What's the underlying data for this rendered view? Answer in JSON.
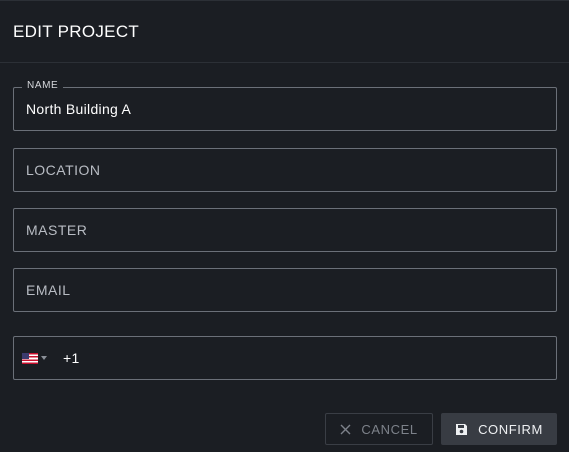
{
  "dialog": {
    "title": "EDIT PROJECT"
  },
  "fields": {
    "name": {
      "label": "NAME",
      "value": "North Building A"
    },
    "location": {
      "placeholder": "LOCATION"
    },
    "master": {
      "placeholder": "MASTER"
    },
    "email": {
      "placeholder": "EMAIL"
    },
    "phone": {
      "country_flag": "us-flag-icon",
      "value": "+1"
    }
  },
  "actions": {
    "cancel_label": "CANCEL",
    "confirm_label": "CONFIRM"
  },
  "colors": {
    "background": "#1b1e23",
    "border": "#6b7078",
    "confirm_bg": "#383c43"
  }
}
